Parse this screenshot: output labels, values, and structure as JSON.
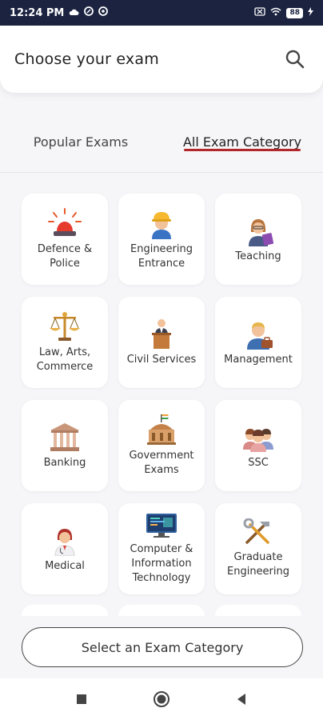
{
  "status_bar": {
    "time": "12:24 PM",
    "battery": "88"
  },
  "header": {
    "title": "Choose your exam",
    "search_icon": "search-icon"
  },
  "tabs": [
    {
      "label": "Popular Exams",
      "active": false
    },
    {
      "label": "All Exam Category",
      "active": true
    }
  ],
  "categories": [
    {
      "label": "Defence &\nPolice",
      "icon": "siren-icon"
    },
    {
      "label": "Engineering\nEntrance",
      "icon": "engineer-icon"
    },
    {
      "label": "Teaching",
      "icon": "teacher-icon"
    },
    {
      "label": "Law, Arts,\nCommerce",
      "icon": "scales-icon"
    },
    {
      "label": "Civil Services",
      "icon": "podium-icon"
    },
    {
      "label": "Management",
      "icon": "manager-icon"
    },
    {
      "label": "Banking",
      "icon": "bank-icon"
    },
    {
      "label": "Government\nExams",
      "icon": "government-building-icon"
    },
    {
      "label": "SSC",
      "icon": "group-icon"
    },
    {
      "label": "Medical",
      "icon": "doctor-icon"
    },
    {
      "label": "Computer &\nInformation\nTechnology",
      "icon": "computer-icon"
    },
    {
      "label": "Graduate\nEngineering",
      "icon": "tools-icon"
    }
  ],
  "cta": {
    "label": "Select an Exam Category"
  },
  "colors": {
    "accent": "#b3262a",
    "status_bar": "#1b2340"
  }
}
